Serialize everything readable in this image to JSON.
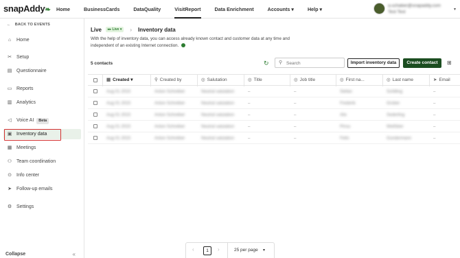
{
  "brand": {
    "name": "snapAddy"
  },
  "nav": {
    "items": [
      {
        "label": "Home"
      },
      {
        "label": "BusinessCards"
      },
      {
        "label": "DataQuality"
      },
      {
        "label": "VisitReport"
      },
      {
        "label": "Data Enrichment"
      },
      {
        "label": "Accounts ▾"
      },
      {
        "label": "Help ▾"
      }
    ],
    "active_index": 3
  },
  "user": {
    "email": "a.schaber@snapaddy.com",
    "name": "Test Test"
  },
  "sidebar": {
    "back_label": "BACK TO EVENTS",
    "items": [
      {
        "label": "Home",
        "icon": "home-icon",
        "glyph": "⌂"
      },
      {
        "label": "Setup",
        "icon": "setup-icon",
        "glyph": "✂"
      },
      {
        "label": "Questionnaire",
        "icon": "questionnaire-icon",
        "glyph": "▤"
      },
      {
        "label": "Reports",
        "icon": "reports-icon",
        "glyph": "▭"
      },
      {
        "label": "Analytics",
        "icon": "analytics-icon",
        "glyph": "▥"
      },
      {
        "label": "Voice AI",
        "icon": "voice-icon",
        "glyph": "◁"
      },
      {
        "label": "Inventory data",
        "icon": "inventory-icon",
        "glyph": "▣"
      },
      {
        "label": "Meetings",
        "icon": "meetings-icon",
        "glyph": "▦"
      },
      {
        "label": "Team coordination",
        "icon": "team-icon",
        "glyph": "⚇"
      },
      {
        "label": "Info center",
        "icon": "info-icon",
        "glyph": "⊙"
      },
      {
        "label": "Follow-up emails",
        "icon": "send-icon",
        "glyph": "➤"
      },
      {
        "label": "Settings",
        "icon": "gear-icon",
        "glyph": "⚙"
      }
    ],
    "beta_label": "Beta",
    "active_label": "Inventory data",
    "collapse_label": "Collapse"
  },
  "header": {
    "live_label": "Live",
    "live_badge": "Live",
    "title": "Inventory data",
    "description": "With the help of inventory data, you can access already known contact and customer data at any time and independent of an existing Internet connection."
  },
  "toolbar": {
    "count_label": "5 contacts",
    "search_placeholder": "Search",
    "import_label": "Import inventory data",
    "create_label": "Create contact"
  },
  "table": {
    "columns": [
      {
        "label": "Created",
        "icon": "calendar-icon",
        "glyph": "▦"
      },
      {
        "label": "Created by",
        "icon": "user-icon",
        "glyph": "⚲"
      },
      {
        "label": "Salutation",
        "icon": "salutation-icon",
        "glyph": "◎"
      },
      {
        "label": "Title",
        "icon": "title-icon",
        "glyph": "◎"
      },
      {
        "label": "Job title",
        "icon": "job-icon",
        "glyph": "◎"
      },
      {
        "label": "First na...",
        "icon": "firstname-icon",
        "glyph": "◎"
      },
      {
        "label": "Last name",
        "icon": "lastname-icon",
        "glyph": "◎"
      },
      {
        "label": "Email",
        "icon": "email-icon",
        "glyph": "➤"
      }
    ],
    "rows": [
      {
        "created": "Aug 01 2023",
        "created_by": "Anton Schreiber",
        "salutation": "Neutral salutation",
        "title": "–",
        "job": "–",
        "first": "Stefan",
        "last": "Schilling",
        "email": "–"
      },
      {
        "created": "Aug 01 2023",
        "created_by": "Anton Schreiber",
        "salutation": "Neutral salutation",
        "title": "–",
        "job": "–",
        "first": "Frederik",
        "last": "Grober",
        "email": "–"
      },
      {
        "created": "Aug 01 2023",
        "created_by": "Anton Schreiber",
        "salutation": "Neutral salutation",
        "title": "–",
        "job": "–",
        "first": "Alix",
        "last": "Sederling",
        "email": "–"
      },
      {
        "created": "Aug 01 2023",
        "created_by": "Anton Schreiber",
        "salutation": "Neutral salutation",
        "title": "–",
        "job": "–",
        "first": "Pinsu",
        "last": "Weißbier",
        "email": "–"
      },
      {
        "created": "Aug 01 2023",
        "created_by": "Anton Schreiber",
        "salutation": "Neutral salutation",
        "title": "–",
        "job": "–",
        "first": "Felin",
        "last": "Gundermann",
        "email": "–"
      }
    ]
  },
  "pagination": {
    "current_page": "1",
    "page_size_label": "25 per page"
  }
}
